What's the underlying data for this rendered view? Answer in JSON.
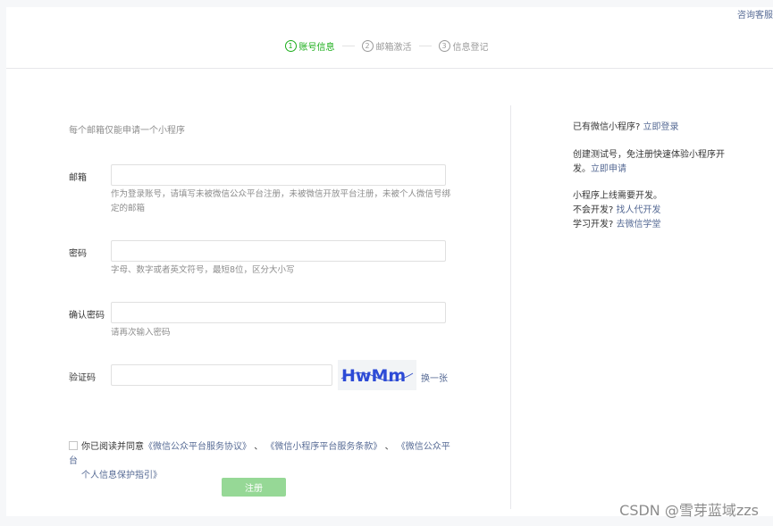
{
  "header": {
    "consult_link": "咨询客服",
    "steps": [
      {
        "num": "1",
        "label": "账号信息",
        "active": true
      },
      {
        "num": "2",
        "label": "邮箱激活",
        "active": false
      },
      {
        "num": "3",
        "label": "信息登记",
        "active": false
      }
    ]
  },
  "form": {
    "intro": "每个邮箱仅能申请一个小程序",
    "email": {
      "label": "邮箱",
      "value": "",
      "hint": "作为登录账号，请填写未被微信公众平台注册，未被微信开放平台注册，未被个人微信号绑定的邮箱"
    },
    "password": {
      "label": "密码",
      "value": "",
      "hint": "字母、数字或者英文符号，最短8位，区分大小写"
    },
    "confirm_password": {
      "label": "确认密码",
      "value": "",
      "hint": "请再次输入密码"
    },
    "captcha": {
      "label": "验证码",
      "value": "",
      "image_text": "HwMm",
      "refresh": "换一张"
    },
    "agreement": {
      "checked": false,
      "prefix": "你已阅读并同意",
      "link1": "《微信公众平台服务协议》",
      "sep1": "、",
      "link2": "《微信小程序平台服务条款》",
      "sep2": "、",
      "link3a": "《微信公众平台",
      "link3b": "个人信息保护指引》"
    },
    "submit": "注册"
  },
  "sidebar": {
    "login_prompt": "已有微信小程序?",
    "login_link": "立即登录",
    "test_prompt": "创建测试号，免注册快速体验小程序开发。",
    "test_link": "立即申请",
    "dev_line1": "小程序上线需要开发。",
    "dev_prompt2": "不会开发?",
    "dev_link2": "找人代开发",
    "dev_prompt3": "学习开发?",
    "dev_link3": "去微信学堂"
  },
  "watermark": "CSDN @雪芽蓝域zzs"
}
